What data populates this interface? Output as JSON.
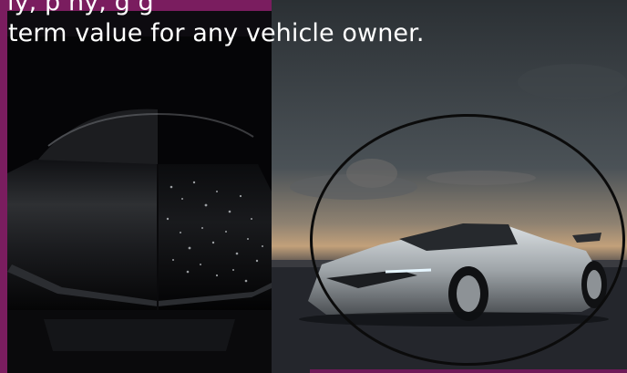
{
  "caption": {
    "line_1": "ly, p                                  ny,                     g   g",
    "line_2": "term value for any vehicle owner."
  },
  "images": {
    "hood_photo": "dark car hood close-up with water droplets",
    "hero_photo": "silver sports car at dusk on tarmac"
  },
  "colors": {
    "accent": "#7a1d5f",
    "text": "#ffffff",
    "ring": "#0b0b0b"
  }
}
